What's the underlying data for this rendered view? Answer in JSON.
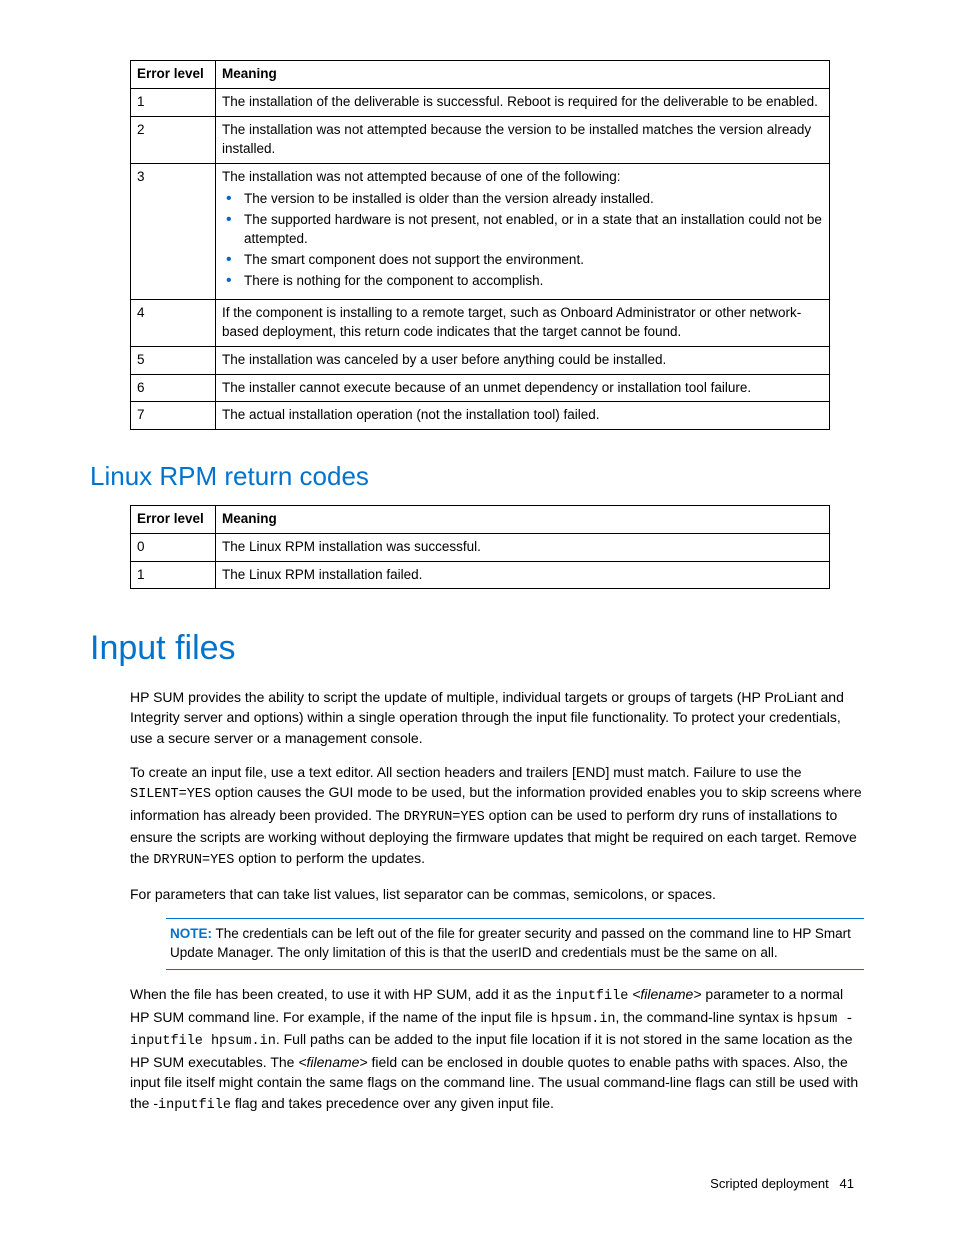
{
  "table1": {
    "headers": [
      "Error level",
      "Meaning"
    ],
    "rows": [
      {
        "level": "1",
        "meaning": "The installation of the deliverable is successful. Reboot is required for the deliverable to be enabled."
      },
      {
        "level": "2",
        "meaning": "The installation was not attempted because the version to be installed matches the version already installed."
      },
      {
        "level": "3",
        "meaning_intro": "The installation was not attempted because of one of the following:",
        "bullets": [
          "The version to be installed is older than the version already installed.",
          "The supported hardware is not present, not enabled, or in a state that an installation could not be attempted.",
          "The smart component does not support the environment.",
          "There is nothing for the component to accomplish."
        ]
      },
      {
        "level": "4",
        "meaning": "If the component is installing to a remote target, such as Onboard Administrator or other network-based deployment, this return code indicates that the target cannot be found."
      },
      {
        "level": "5",
        "meaning": "The installation was canceled by a user before anything could be installed."
      },
      {
        "level": "6",
        "meaning": "The installer cannot execute because of an unmet dependency or installation tool failure."
      },
      {
        "level": "7",
        "meaning": "The actual installation operation (not the installation tool) failed."
      }
    ]
  },
  "heading_rpm": "Linux RPM return codes",
  "table2": {
    "headers": [
      "Error level",
      "Meaning"
    ],
    "rows": [
      {
        "level": "0",
        "meaning": "The Linux RPM installation was successful."
      },
      {
        "level": "1",
        "meaning": "The Linux RPM installation failed."
      }
    ]
  },
  "heading_input": "Input files",
  "para1": "HP SUM provides the ability to script the update of multiple, individual targets or groups of targets (HP ProLiant and Integrity server and options) within a single operation through the input file functionality. To protect your credentials, use a secure server or a management console.",
  "para2": {
    "seg1": "To create an input file, use a text editor. All section headers and trailers [END] must match. Failure to use the ",
    "code1": "SILENT=YES",
    "seg2": " option causes the GUI mode to be used, but the information provided enables you to skip screens where information has already been provided. The ",
    "code2": "DRYRUN=YES",
    "seg3": " option can be used to perform dry runs of installations to ensure the scripts are working without deploying the firmware updates that might be required on each target. Remove the ",
    "code3": "DRYRUN=YES",
    "seg4": " option to perform the updates."
  },
  "para3": "For parameters that can take list values, list separator can be commas, semicolons, or spaces.",
  "note": {
    "label": "NOTE:",
    "text": " The credentials can be left out of the file for greater security and passed on the command line to HP Smart Update Manager. The only limitation of this is that the userID and credentials must be the same on all."
  },
  "para4": {
    "seg1": "When the file has been created, to use it with HP SUM, add it as the ",
    "code1": "inputfile",
    "seg2": " ",
    "ital1": "<filename>",
    "seg3": " parameter to a normal HP SUM command line. For example, if the name of the input file is ",
    "code2": "hpsum.in",
    "seg4": ", the command-line syntax is ",
    "code3": "hpsum -inputfile hpsum.in",
    "seg5": ". Full paths can be added to the input file location if it is not stored in the same location as the HP SUM executables. The ",
    "ital2": "<filename>",
    "seg6": " field can be enclosed in double quotes to enable paths with spaces. Also, the input file itself might contain the same flags on the command line. The usual command-line flags can still be used with the -",
    "code4": "inputfile",
    "seg7": " flag and takes precedence over any given input file."
  },
  "footer": {
    "section": "Scripted deployment",
    "page": "41"
  }
}
